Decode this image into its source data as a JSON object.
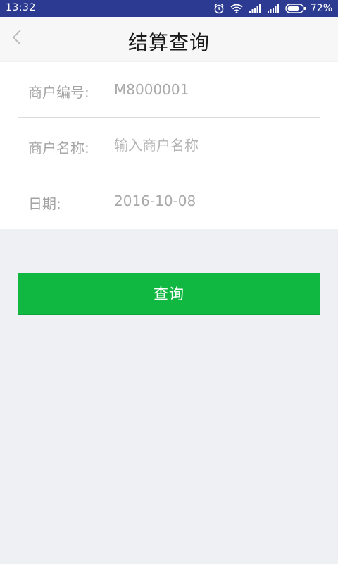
{
  "status_bar": {
    "time": "13:32",
    "battery": "72%",
    "icons": [
      "alarm-icon",
      "wifi-icon",
      "signal-icon",
      "signal-icon",
      "battery-icon"
    ]
  },
  "nav": {
    "back_icon": "chevron-left-icon",
    "title": "结算查询"
  },
  "form": {
    "merchant_id": {
      "label": "商户编号:",
      "value": "M8000001"
    },
    "merchant_name": {
      "label": "商户名称:",
      "placeholder": "输入商户名称"
    },
    "date": {
      "label": "日期:",
      "value": "2016-10-08"
    }
  },
  "actions": {
    "query_label": "查询"
  },
  "colors": {
    "status_bar": "#2c3b91",
    "primary": "#10b842",
    "background": "#eff0f4"
  }
}
